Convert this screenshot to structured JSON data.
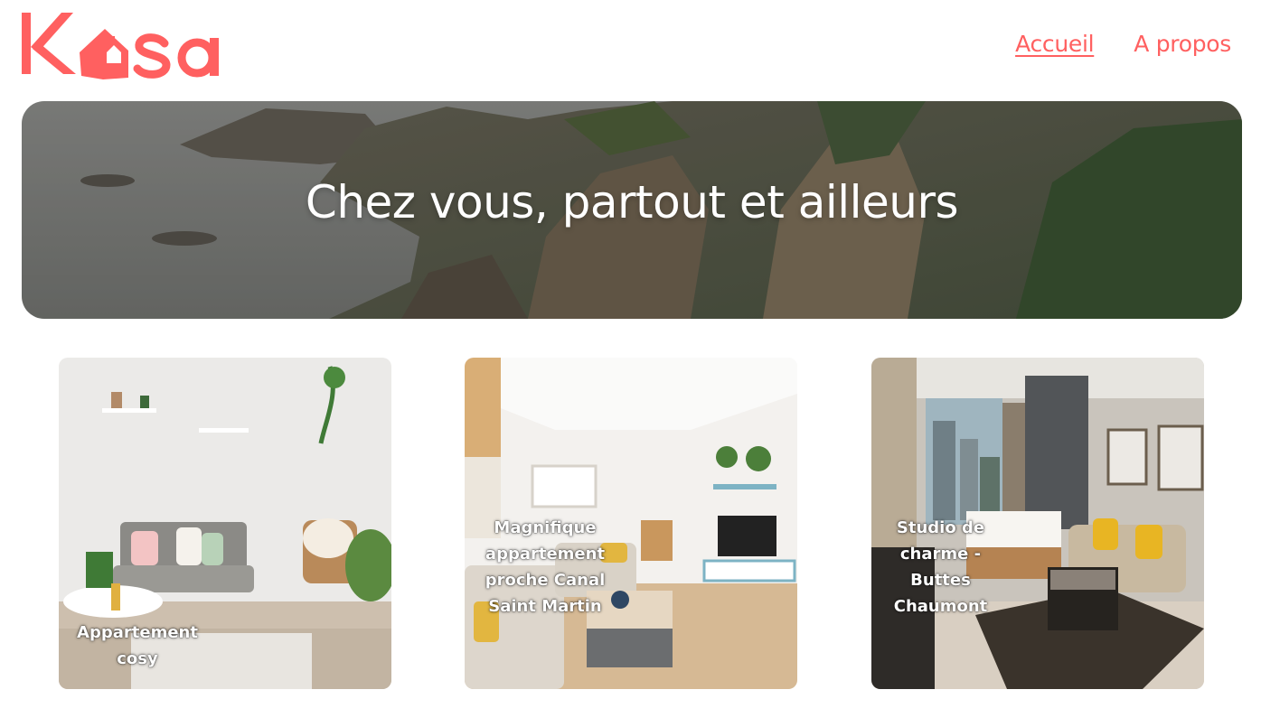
{
  "header": {
    "logo_text": "Kasa",
    "nav": [
      {
        "label": "Accueil",
        "active": true
      },
      {
        "label": "A propos",
        "active": false
      }
    ]
  },
  "banner": {
    "title": "Chez vous, partout et ailleurs"
  },
  "listings": [
    {
      "title": "Appartement cosy"
    },
    {
      "title": "Magnifique appartement proche Canal Saint Martin"
    },
    {
      "title": "Studio de charme - Buttes Chaumont"
    }
  ],
  "colors": {
    "brand": "#FF6060",
    "text_on_image": "#FFFFFF"
  }
}
